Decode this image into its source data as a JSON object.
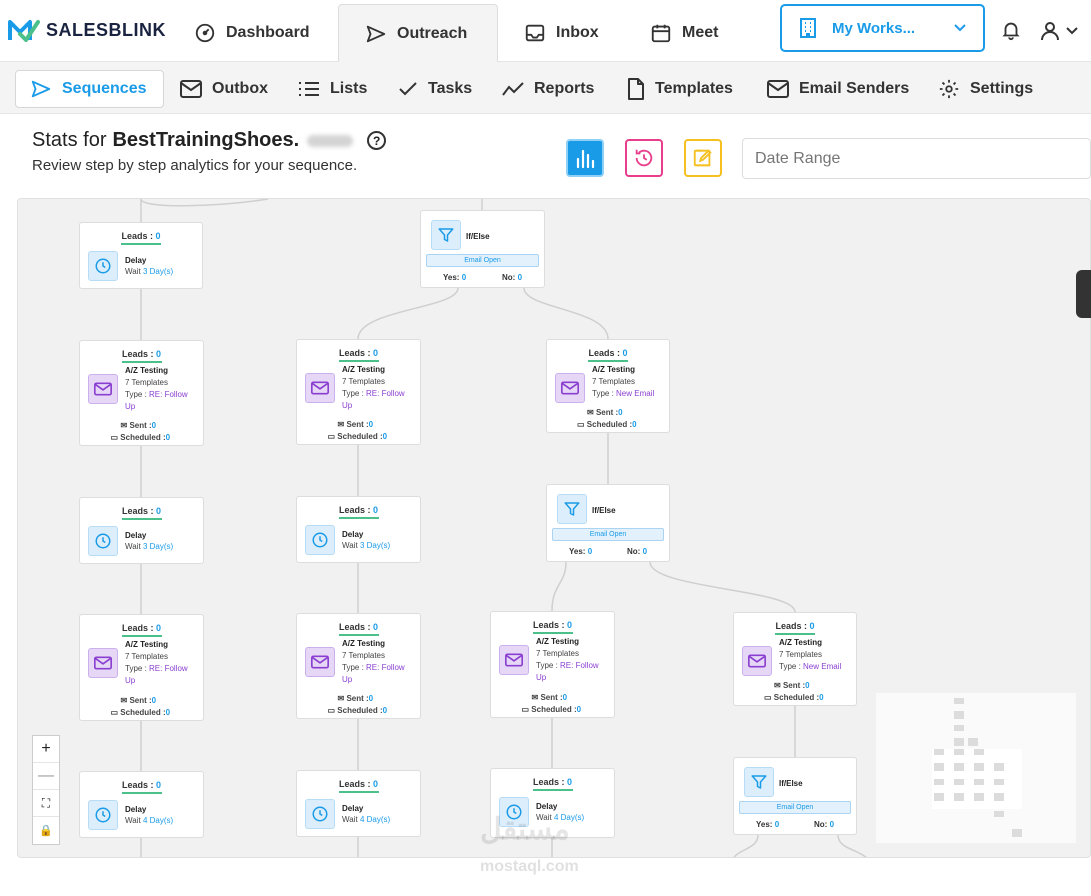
{
  "brand": {
    "name": "SALESBLINK",
    "accent": "#1a9be8"
  },
  "top_nav": {
    "tabs": [
      {
        "label": "Dashboard",
        "icon": "speedometer-icon"
      },
      {
        "label": "Outreach",
        "icon": "send-icon"
      },
      {
        "label": "Inbox",
        "icon": "inbox-icon"
      },
      {
        "label": "Meet",
        "icon": "calendar-icon"
      }
    ],
    "active": "Outreach",
    "workspace_label": "My Works...",
    "workspace_icon": "building-icon"
  },
  "sub_nav": {
    "tabs": [
      {
        "label": "Sequences",
        "icon": "send-icon"
      },
      {
        "label": "Outbox",
        "icon": "mail-icon"
      },
      {
        "label": "Lists",
        "icon": "list-icon"
      },
      {
        "label": "Tasks",
        "icon": "check-icon"
      },
      {
        "label": "Reports",
        "icon": "trend-icon"
      },
      {
        "label": "Templates",
        "icon": "document-icon"
      },
      {
        "label": "Email Senders",
        "icon": "mail-icon"
      },
      {
        "label": "Settings",
        "icon": "gear-icon"
      }
    ],
    "active": "Sequences"
  },
  "header": {
    "title_prefix": "Stats for",
    "sequence_name": "BestTrainingShoes.",
    "subtitle": "Review step by step analytics for your sequence.",
    "date_range_placeholder": "Date Range"
  },
  "flow": {
    "leads_label": "Leads : ",
    "delay_title": "Delay",
    "wait_label": "Wait",
    "abtest_title": "A/Z Testing",
    "templates_text": "7 Templates",
    "type_label": "Type : ",
    "sent_label": "Sent :",
    "scheduled_label": "Scheduled :",
    "ifelse_title": "If/Else",
    "condition": "Email Open",
    "yes_label": "Yes:",
    "no_label": "No:",
    "nodes": [
      {
        "kind": "delay",
        "leads": "0",
        "wait": "3 Day(s)"
      },
      {
        "kind": "ifelse",
        "leads": "",
        "yes": "0",
        "no": "0"
      },
      {
        "kind": "abtest",
        "leads": "0",
        "type": "RE: Follow Up",
        "sent": "0",
        "scheduled": "0"
      },
      {
        "kind": "abtest",
        "leads": "0",
        "type": "RE: Follow Up",
        "sent": "0",
        "scheduled": "0"
      },
      {
        "kind": "abtest",
        "leads": "0",
        "type": "New Email",
        "sent": "0",
        "scheduled": "0"
      },
      {
        "kind": "ifelse",
        "leads": "",
        "yes": "0",
        "no": "0"
      },
      {
        "kind": "delay",
        "leads": "0",
        "wait": "3 Day(s)"
      },
      {
        "kind": "delay",
        "leads": "0",
        "wait": "3 Day(s)"
      },
      {
        "kind": "abtest",
        "leads": "0",
        "type": "RE: Follow Up",
        "sent": "0",
        "scheduled": "0"
      },
      {
        "kind": "abtest",
        "leads": "0",
        "type": "RE: Follow Up",
        "sent": "0",
        "scheduled": "0"
      },
      {
        "kind": "abtest",
        "leads": "0",
        "type": "RE: Follow Up",
        "sent": "0",
        "scheduled": "0"
      },
      {
        "kind": "abtest",
        "leads": "0",
        "type": "New Email",
        "sent": "0",
        "scheduled": "0"
      },
      {
        "kind": "delay",
        "leads": "0",
        "wait": "4 Day(s)"
      },
      {
        "kind": "delay",
        "leads": "0",
        "wait": "4 Day(s)"
      },
      {
        "kind": "delay",
        "leads": "0",
        "wait": "4 Day(s)"
      },
      {
        "kind": "ifelse",
        "leads": "",
        "yes": "0",
        "no": "0"
      }
    ]
  },
  "zoom_controls": [
    "+",
    "—",
    "⛶",
    "🔒"
  ],
  "watermark": {
    "text": "مستقل",
    "domain": "mostaql.com"
  }
}
